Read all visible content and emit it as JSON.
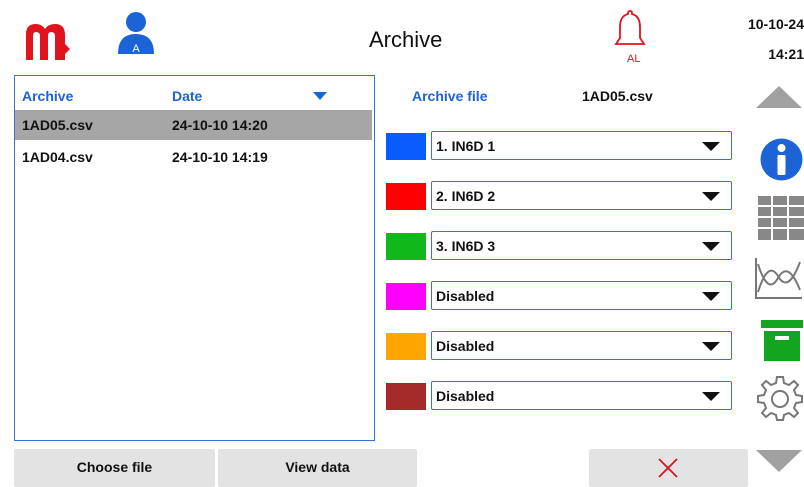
{
  "header": {
    "title": "Archive",
    "user_badge": "A",
    "alarm_label": "AL",
    "date": "10-10-24",
    "time": "14:21"
  },
  "file_list": {
    "columns": [
      "Archive",
      "Date"
    ],
    "rows": [
      {
        "name": "1AD05.csv",
        "date": "24-10-10 14:20",
        "selected": true
      },
      {
        "name": "1AD04.csv",
        "date": "24-10-10 14:19",
        "selected": false
      }
    ]
  },
  "archive_file": {
    "label": "Archive file",
    "value": "1AD05.csv"
  },
  "channels": [
    {
      "color": "#0a5cff",
      "selected": "1. IN6D 1"
    },
    {
      "color": "#ff0000",
      "selected": "2. IN6D 2"
    },
    {
      "color": "#10b81a",
      "selected": "3. IN6D 3"
    },
    {
      "color": "#ff00ff",
      "selected": "Disabled"
    },
    {
      "color": "#ffa500",
      "selected": "Disabled"
    },
    {
      "color": "#a52a2a",
      "selected": "Disabled"
    }
  ],
  "buttons": {
    "choose_file": "Choose file",
    "view_data": "View data"
  },
  "nav_icons": [
    "scroll-up-icon",
    "info-icon",
    "table-icon",
    "chart-icon",
    "archive-icon",
    "settings-icon",
    "scroll-down-icon"
  ],
  "colors": {
    "brand": "#e0141e",
    "accent": "#1c63d6",
    "active_nav": "#12a51e",
    "selection": "#a6a6a6"
  }
}
